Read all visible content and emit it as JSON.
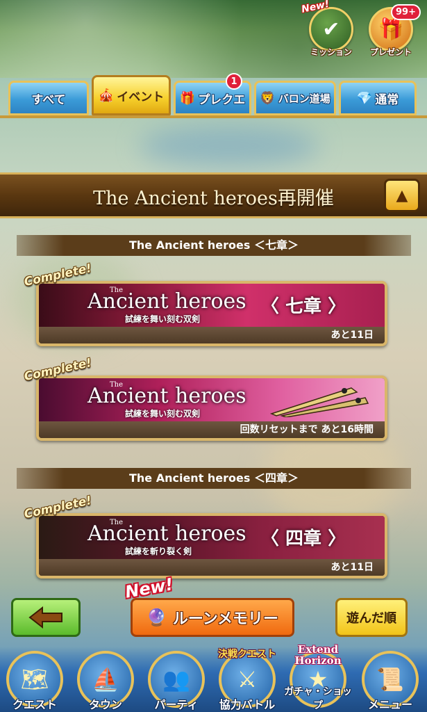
{
  "header": {
    "mission": {
      "label": "ミッション",
      "new_badge": "New!",
      "icon": "mission-board-icon"
    },
    "present": {
      "label": "プレゼント",
      "count_badge": "99+",
      "icon": "gift-box-icon"
    }
  },
  "tabs": [
    {
      "label": "すべて",
      "icon": ""
    },
    {
      "label": "イベント",
      "icon": "event-icon",
      "active": true
    },
    {
      "label": "プレクエ",
      "icon": "present-quest-icon",
      "badge": "1"
    },
    {
      "label": "バロン道場",
      "icon": "baron-icon"
    },
    {
      "label": "通常",
      "icon": "normal-quest-icon"
    }
  ],
  "section": {
    "title": "The Ancient heroes再開催",
    "collapse_icon": "triangle-up-icon"
  },
  "groups": [
    {
      "heading": "The Ancient heroes ＜七章＞",
      "banners": [
        {
          "complete": "Complete!",
          "logo_the": "The",
          "logo": "Ancient heroes",
          "subtitle": "試練を舞い刻む双剣",
          "chapter": "〈 七章 〉",
          "footer": "あと11日",
          "color": "#8a1a3a"
        },
        {
          "complete": "Complete!",
          "logo_the": "The",
          "logo": "Ancient heroes",
          "subtitle": "試練を舞い刻む双剣",
          "chapter": "",
          "footer": "回数リセットまで あと16時間",
          "color": "#b0205a"
        }
      ]
    },
    {
      "heading": "The Ancient heroes ＜四章＞",
      "banners": [
        {
          "complete": "Complete!",
          "logo_the": "The",
          "logo": "Ancient heroes",
          "subtitle": "試練を斬り裂く剣",
          "chapter": "〈 四章 〉",
          "footer": "あと11日",
          "color": "#6a1430"
        }
      ]
    }
  ],
  "controls": {
    "back_icon": "left-arrow-icon",
    "rune_new": "New!",
    "rune_label": "ルーンメモリー",
    "sort_label": "遊んだ順"
  },
  "nav": [
    {
      "label": "クエスト",
      "icon": "quest-map-icon"
    },
    {
      "label": "タウン",
      "icon": "airship-icon"
    },
    {
      "label": "パーティ",
      "icon": "party-icon"
    },
    {
      "label": "協力バトル",
      "icon": "coop-battle-icon",
      "tag": "決戦クエスト"
    },
    {
      "label": "ガチャ・ショップ",
      "icon": "gacha-icon",
      "tag": "Extend Horizon"
    },
    {
      "label": "メニュー",
      "icon": "menu-book-icon"
    }
  ]
}
